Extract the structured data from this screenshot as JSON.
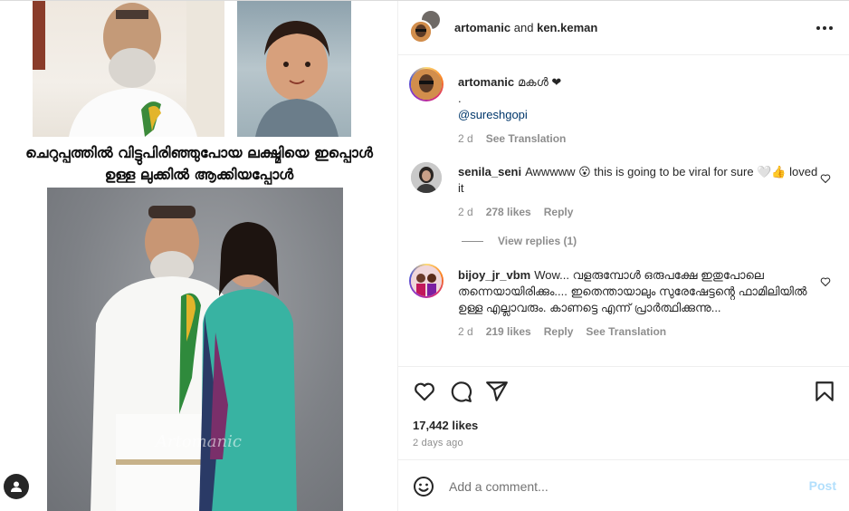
{
  "media": {
    "caption_line1": "ചെറുപ്പത്തിൽ വിട്ടുപിരിഞ്ഞുപോയ ലക്ഷ്മിയെ ഇപ്പൊൾ",
    "caption_line2": "ഉള്ള ലുക്കിൽ ആക്കിയപ്പോൾ",
    "watermark": "Artomanic"
  },
  "header": {
    "user1": "artomanic",
    "and": "and",
    "user2": "ken.keman"
  },
  "comments": [
    {
      "user": "artomanic",
      "text_line1": "മകൾ ❤",
      "text_line2": ".",
      "mention": "@sureshgopi",
      "time": "2 d",
      "see_translation": "See Translation"
    },
    {
      "user": "senila_seni",
      "text": "Awwwww 😮 this is going to be viral for sure 🤍👍 loved it",
      "time": "2 d",
      "likes": "278 likes",
      "reply": "Reply",
      "view_replies": "View replies (1)"
    },
    {
      "user": "bijoy_jr_vbm",
      "text": "Wow... വളരുമ്പോൾ ഒരുപക്ഷേ ഇതുപോലെ തന്നെയായിരിക്കും.... ഇതെന്തായാലും സുരേഷേട്ടൻ്റെ ഫാമിലിയിൽ ഉള്ള എല്ലാവരും. കാണട്ടെ എന്ന് പ്രാർത്ഥിക്കുന്നു...",
      "time": "2 d",
      "likes": "219 likes",
      "reply": "Reply",
      "see_translation": "See Translation"
    }
  ],
  "actions": {
    "likes": "17,442 likes",
    "ago": "2 days ago"
  },
  "add_comment": {
    "placeholder": "Add a comment...",
    "post_label": "Post"
  },
  "icons": [
    "more-icon",
    "heart-icon",
    "comment-icon",
    "share-icon",
    "bookmark-icon",
    "emoji-icon",
    "user-tag-icon"
  ],
  "colors": {
    "link": "#00376b",
    "muted": "#8e8e8e",
    "post_disabled": "#b2dffc",
    "heart_red": "#ed4956"
  }
}
